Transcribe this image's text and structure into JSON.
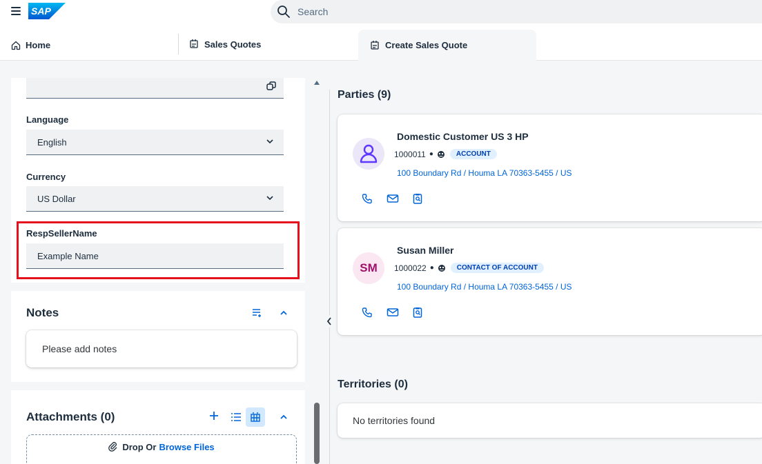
{
  "shell": {
    "search_placeholder": "Search",
    "logo_text": "SAP"
  },
  "tabs": [
    {
      "label": "Home",
      "icon": "home-icon"
    },
    {
      "label": "Sales Quotes",
      "icon": "sales-quote-icon"
    },
    {
      "label": "Create Sales Quote",
      "icon": "sales-quote-icon",
      "active": true
    }
  ],
  "form": {
    "language": {
      "label": "Language",
      "value": "English"
    },
    "currency": {
      "label": "Currency",
      "value": "US Dollar"
    },
    "resp_seller": {
      "label": "RespSellerName",
      "value": "Example Name"
    }
  },
  "notes": {
    "title": "Notes",
    "placeholder": "Please add notes"
  },
  "attachments": {
    "title": "Attachments (0)",
    "drop_text": "Drop Or",
    "browse_text": "Browse Files"
  },
  "parties": {
    "title": "Parties (9)",
    "items": [
      {
        "name": "Domestic Customer US 3 HP",
        "id": "1000011",
        "role": "ACCOUNT",
        "address": "100 Boundary Rd / Houma LA 70363-5455 / US",
        "avatar": "person-icon"
      },
      {
        "name": "Susan Miller",
        "id": "1000022",
        "role": "CONTACT OF ACCOUNT",
        "address": "100 Boundary Rd / Houma LA 70363-5455 / US",
        "initials": "SM"
      }
    ]
  },
  "territories": {
    "title": "Territories (0)",
    "empty_text": "No territories found"
  },
  "colors": {
    "brand": "#0070f2",
    "link": "#0064d9",
    "highlight": "#e4101c"
  }
}
